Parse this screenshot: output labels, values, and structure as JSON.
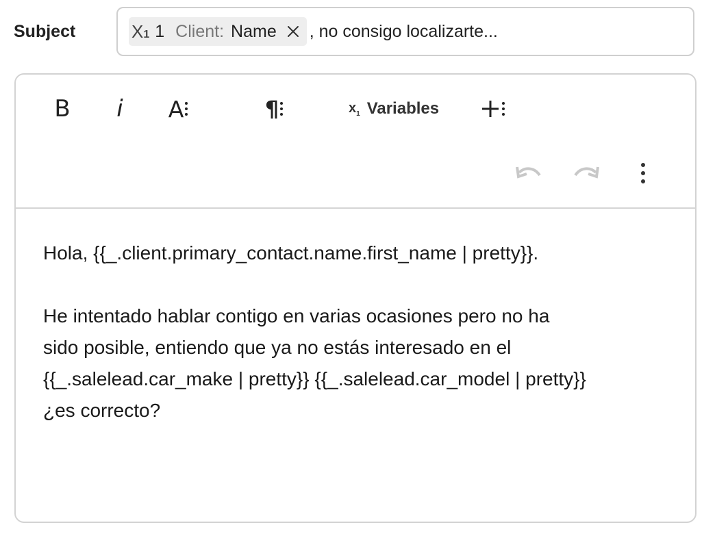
{
  "subject": {
    "label": "Subject",
    "chip": {
      "icon": "variable-icon",
      "icon_x": "X",
      "icon_sub": "1",
      "number": "1",
      "prefix": "Client:",
      "name": "Name"
    },
    "text": ", no consigo localizarte..."
  },
  "toolbar": {
    "bold": "B",
    "italic": "i",
    "font": "A",
    "paragraph": "¶",
    "variables_icon_x": "x",
    "variables_icon_sub": "1",
    "variables": "Variables",
    "insert": "+"
  },
  "body": {
    "line1": "Hola, {{_.client.primary_contact.name.first_name | pretty}}.",
    "line2": "He intentado hablar contigo en varias ocasiones pero no ha",
    "line3": "sido posible, entiendo que ya no estás interesado en el",
    "line4": "{{_.salelead.car_make | pretty}} {{_.salelead.car_model | pretty}}",
    "line5": "¿es correcto?"
  }
}
